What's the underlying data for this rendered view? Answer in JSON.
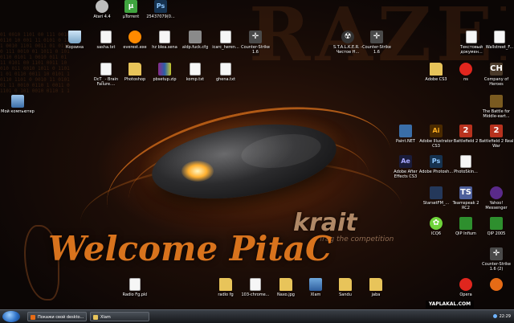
{
  "wallpaper": {
    "brand": "RAZER",
    "welcome": "Welcome PitaC",
    "product": "krait",
    "tagline": "frag the competition"
  },
  "icons": [
    {
      "id": "atari",
      "label": "Atari 4.4",
      "type": "atari"
    },
    {
      "id": "utorrent",
      "label": "µTorrent",
      "type": "utorrent"
    },
    {
      "id": "img-25437",
      "label": "25437079(0...",
      "type": "ps"
    },
    {
      "id": "recycle",
      "label": "Корзина",
      "type": "bin"
    },
    {
      "id": "sasha",
      "label": "sasha.txt",
      "type": "doc"
    },
    {
      "id": "everest",
      "label": "everest.exe",
      "type": "everest"
    },
    {
      "id": "hzblea",
      "label": "hz blea.sena",
      "type": "doc"
    },
    {
      "id": "aldp",
      "label": "aldp.fuck.cfg",
      "type": "mesh"
    },
    {
      "id": "icarc",
      "label": "icarc_heren...",
      "type": "doc"
    },
    {
      "id": "cs16a",
      "label": "Counter-Strike 1.6",
      "type": "cs"
    },
    {
      "id": "stalker",
      "label": "S.T.A.L.K.E.R. - Чистое Н...",
      "type": "stalker"
    },
    {
      "id": "cs16b",
      "label": "Counter-Strike 1.6",
      "type": "cs"
    },
    {
      "id": "textdoc",
      "label": "Текстовый докумен...",
      "type": "doc"
    },
    {
      "id": "wallstreet",
      "label": "Wallstreet_F...",
      "type": "doc"
    },
    {
      "id": "dcf",
      "label": "DcT_ - Brain Failure....",
      "type": "doc"
    },
    {
      "id": "photoshop",
      "label": "Photoshop",
      "type": "folder"
    },
    {
      "id": "pbsetup",
      "label": "pbsetup.zip",
      "type": "rar"
    },
    {
      "id": "komp",
      "label": "komp.txt",
      "type": "doc"
    },
    {
      "id": "ghena",
      "label": "ghena.txt",
      "type": "doc"
    },
    {
      "id": "mypc",
      "label": "Мой компьютер",
      "type": "pc"
    },
    {
      "id": "adobecs3",
      "label": "Adobe CS3",
      "type": "folder"
    },
    {
      "id": "ns",
      "label": "ns",
      "type": "opera"
    },
    {
      "id": "coh",
      "label": "Company of Heroes",
      "type": "coh"
    },
    {
      "id": "lotr",
      "label": "The Battle for Middle-eart...",
      "type": "lotr"
    },
    {
      "id": "paintnet",
      "label": "Paint.NET",
      "type": "paint"
    },
    {
      "id": "illustrator",
      "label": "Adobe Illustrator CS3",
      "type": "ai"
    },
    {
      "id": "bf2",
      "label": "Battlefield 2",
      "type": "bf"
    },
    {
      "id": "bf2rw",
      "label": "Battlefield 2 Real War",
      "type": "bf"
    },
    {
      "id": "aftereffects",
      "label": "Adobe After Effects CS3",
      "type": "ae"
    },
    {
      "id": "photoshopcs3",
      "label": "Adobe Photosh...",
      "type": "ps"
    },
    {
      "id": "photoskin",
      "label": "PhotoSkin...",
      "type": "doc"
    },
    {
      "id": "starsfm",
      "label": "StarsetFM_...",
      "type": "starcraft"
    },
    {
      "id": "teamspeak",
      "label": "Teamspeak 2 RC2",
      "type": "ts"
    },
    {
      "id": "yahoo",
      "label": "Yahoo! Messenger",
      "type": "yahoo"
    },
    {
      "id": "icq",
      "label": "ICQ6",
      "type": "icq"
    },
    {
      "id": "qipinfium",
      "label": "QIP Infium",
      "type": "qip"
    },
    {
      "id": "qip2005",
      "label": "QIP 2005",
      "type": "qip"
    },
    {
      "id": "cs16c",
      "label": "Counter-Strike 1.6 (2)",
      "type": "cs"
    },
    {
      "id": "radio",
      "label": "Radio Fg.pkl",
      "type": "doc"
    },
    {
      "id": "radiofg",
      "label": "radio fg",
      "type": "folder"
    },
    {
      "id": "chrome",
      "label": "103-chrome...",
      "type": "doc"
    },
    {
      "id": "naxo",
      "label": "Naxo.jpg",
      "type": "folder"
    },
    {
      "id": "xlam",
      "label": "Xlam",
      "type": "img"
    },
    {
      "id": "sandu",
      "label": "Sandu",
      "type": "folder"
    },
    {
      "id": "jaba",
      "label": "jaba",
      "type": "folder"
    },
    {
      "id": "opera",
      "label": "Opera",
      "type": "opera"
    },
    {
      "id": "firefox",
      "label": "",
      "type": "firefox"
    }
  ],
  "taskbar": {
    "tasks": [
      {
        "label": "Покажи свой deskto...",
        "color": "#e66b16"
      },
      {
        "label": "Xlam",
        "color": "#e8c45a"
      }
    ],
    "clock": "22:29"
  },
  "watermark": "YAPLAKAL.COM"
}
